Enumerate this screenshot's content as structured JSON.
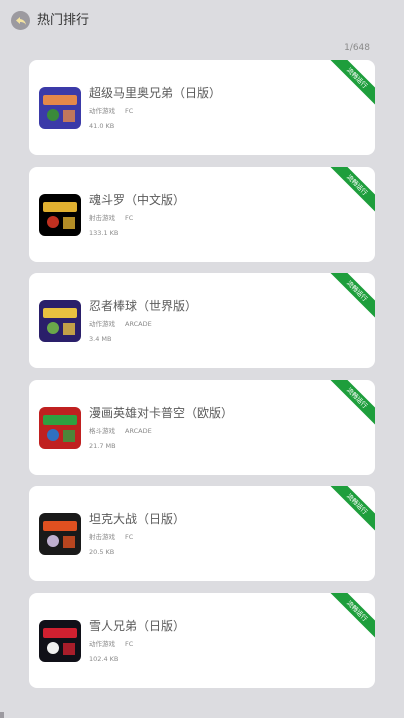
{
  "header": {
    "title": "热门排行"
  },
  "pager": {
    "text": "1/648"
  },
  "games": [
    {
      "name": "超级马里奥兄弟（日版）",
      "genre": "动作游戏",
      "platform": "FC",
      "size": "41.0 KB",
      "badge": "流畅运行",
      "thumb_colors": [
        "#3b3aa8",
        "#e4884a",
        "#3a8a3a"
      ]
    },
    {
      "name": "魂斗罗（中文版）",
      "genre": "射击游戏",
      "platform": "FC",
      "size": "133.1 KB",
      "badge": "流畅运行",
      "thumb_colors": [
        "#000000",
        "#e0b030",
        "#c03020"
      ]
    },
    {
      "name": "忍者棒球（世界版）",
      "genre": "动作游戏",
      "platform": "ARCADE",
      "size": "3.4 MB",
      "badge": "流畅运行",
      "thumb_colors": [
        "#2a1f6a",
        "#e8c040",
        "#6aa84a"
      ]
    },
    {
      "name": "漫画英雄对卡普空（欧版）",
      "genre": "格斗游戏",
      "platform": "ARCADE",
      "size": "21.7 MB",
      "badge": "流畅运行",
      "thumb_colors": [
        "#c02020",
        "#30a040",
        "#3070c0"
      ]
    },
    {
      "name": "坦克大战（日版）",
      "genre": "射击游戏",
      "platform": "FC",
      "size": "20.5 KB",
      "badge": "流畅运行",
      "thumb_colors": [
        "#1a1a1a",
        "#e05020",
        "#c0b0d0"
      ]
    },
    {
      "name": "雪人兄弟（日版）",
      "genre": "动作游戏",
      "platform": "FC",
      "size": "102.4 KB",
      "badge": "流畅运行",
      "thumb_colors": [
        "#101018",
        "#d02030",
        "#f0f0f0"
      ]
    }
  ]
}
